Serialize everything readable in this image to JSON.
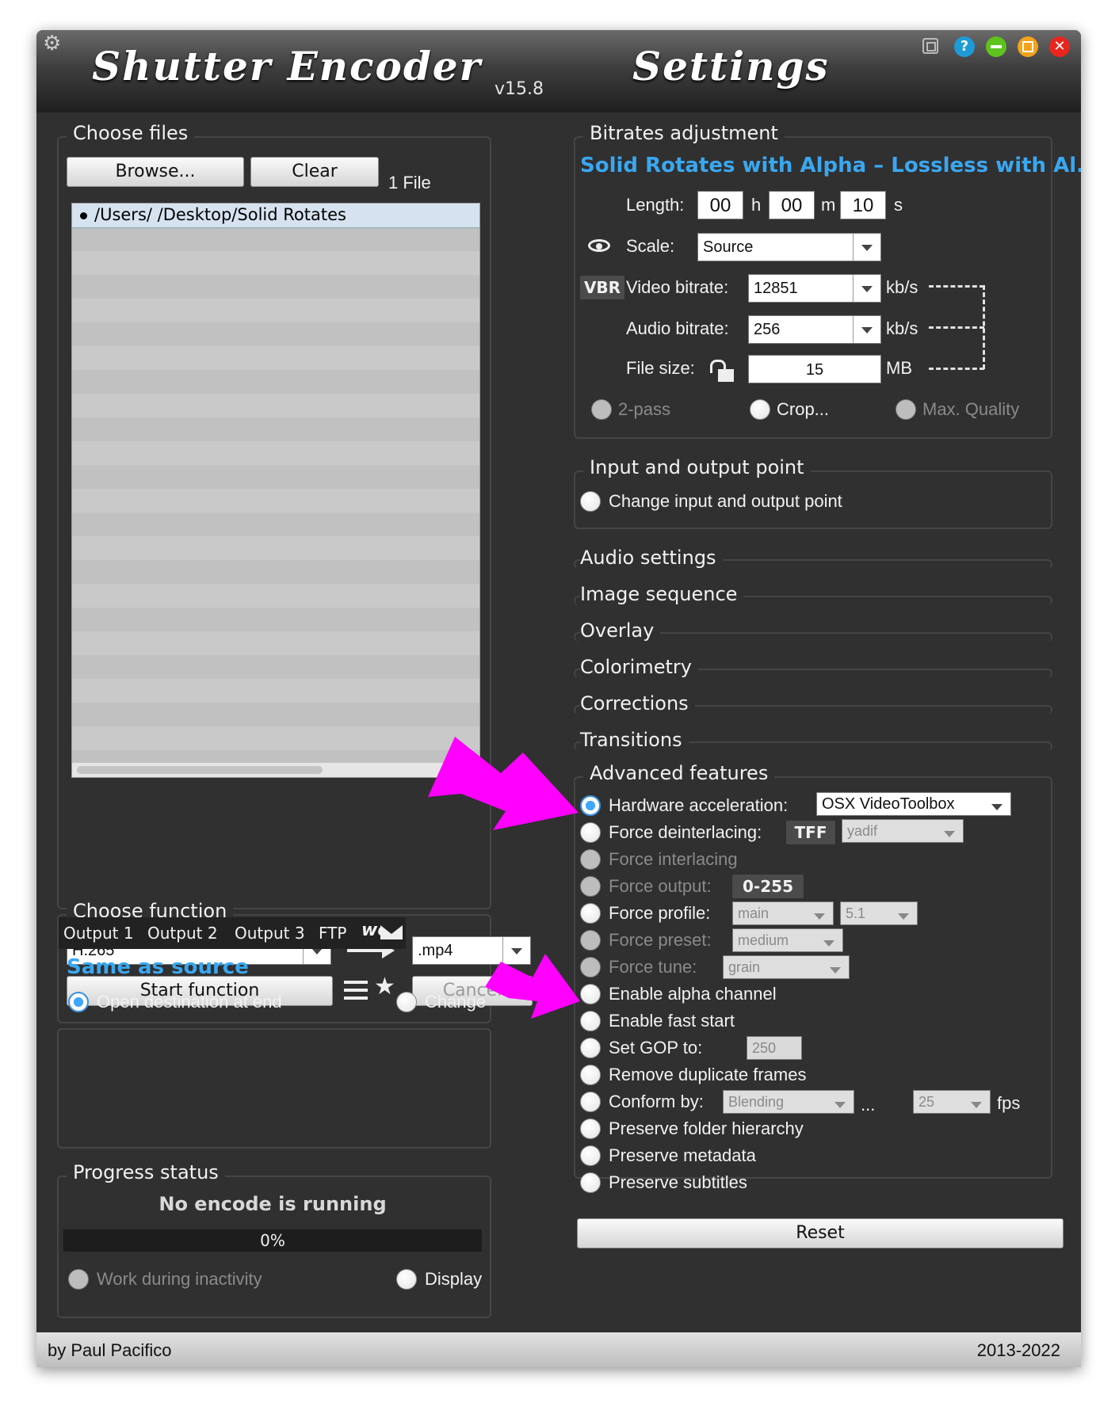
{
  "app": {
    "title": "Shutter Encoder",
    "version": "v15.8",
    "settings_title": "Settings",
    "author": "by Paul Pacifico",
    "years": "2013-2022",
    "colors": {
      "accent": "#3aa7f0",
      "annotation": "#ff00ff",
      "background": "#303030"
    }
  },
  "titlebar": {
    "icons": [
      "gear-icon",
      "copy-icon",
      "help-icon",
      "minimize-icon",
      "fullscreen-icon",
      "close-icon"
    ],
    "help": "?",
    "close": "✕"
  },
  "choose_files": {
    "title": "Choose files",
    "browse_label": "Browse...",
    "clear_label": "Clear",
    "file_count": "1 File",
    "files": [
      "/Users/ /Desktop/Solid Rotates"
    ]
  },
  "choose_function": {
    "title": "Choose function",
    "function": "H.265",
    "extension": ".mp4",
    "start_label": "Start function",
    "cancel_label": "Cancel"
  },
  "output": {
    "tabs": [
      "Output 1",
      "Output 2",
      "Output 3",
      "FTP"
    ],
    "destination": "Same as source",
    "open_destination": "Open destination at end",
    "open_destination_checked": true,
    "change_label": "Change"
  },
  "progress": {
    "title": "Progress status",
    "status": "No encode is running",
    "percent": "0%",
    "percent_value": 0,
    "work_inactivity": "Work during inactivity",
    "display": "Display"
  },
  "bitrates": {
    "title": "Bitrates adjustment",
    "preset": "Solid Rotates with Alpha – Lossless with Al...",
    "length_label": "Length:",
    "hours": "00",
    "h": "h",
    "minutes": "00",
    "m": "m",
    "seconds": "10",
    "s": "s",
    "scale_label": "Scale:",
    "scale": "Source",
    "vbr": "VBR",
    "video_bitrate_label": "Video bitrate:",
    "video_bitrate": "12851",
    "audio_bitrate_label": "Audio bitrate:",
    "audio_bitrate": "256",
    "kbs": "kb/s",
    "file_size_label": "File size:",
    "file_size": "15",
    "mb": "MB",
    "two_pass": "2-pass",
    "crop": "Crop...",
    "max_quality": "Max. Quality"
  },
  "io_point": {
    "title": "Input and output point",
    "change": "Change input and output point"
  },
  "sections": [
    "Audio settings",
    "Image sequence",
    "Overlay",
    "Colorimetry",
    "Corrections",
    "Transitions"
  ],
  "advanced": {
    "title": "Advanced features",
    "hw_accel": "Hardware acceleration:",
    "hw_accel_value": "OSX VideoToolbox",
    "hw_accel_checked": true,
    "deinterlace": "Force deinterlacing:",
    "tff": "TFF",
    "deinterlace_value": "yadif",
    "interlacing": "Force interlacing",
    "output": "Force output:",
    "output_value": "0-255",
    "profile": "Force profile:",
    "profile_value": "main",
    "level_value": "5.1",
    "preset": "Force preset:",
    "preset_value": "medium",
    "tune": "Force tune:",
    "tune_value": "grain",
    "alpha": "Enable alpha channel",
    "fast_start": "Enable fast start",
    "gop": "Set GOP to:",
    "gop_value": "250",
    "dup_frames": "Remove duplicate frames",
    "conform": "Conform by:",
    "conform_value": "Blending",
    "ellipsis": "...",
    "fps_value": "25",
    "fps": "fps",
    "folder_hierarchy": "Preserve folder hierarchy",
    "metadata": "Preserve metadata",
    "subtitles": "Preserve subtitles",
    "reset_label": "Reset"
  }
}
